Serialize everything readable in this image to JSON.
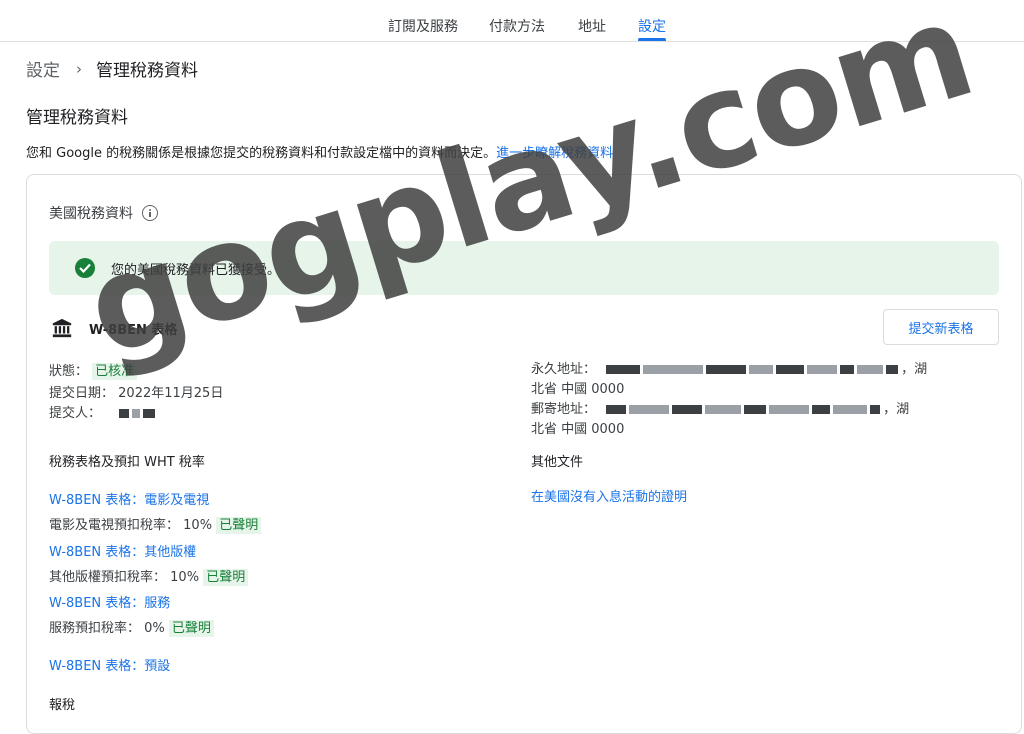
{
  "nav": {
    "tabs": [
      {
        "label": "訂閱及服務"
      },
      {
        "label": "付款方法"
      },
      {
        "label": "地址"
      },
      {
        "label": "設定",
        "active": true
      }
    ]
  },
  "breadcrumb": {
    "root": "設定",
    "current": "管理稅務資料"
  },
  "page": {
    "title": "管理稅務資料",
    "description": "您和 Google 的稅務關係是根據您提交的稅務資料和付款設定檔中的資料而決定。",
    "learn_more": "進一步瞭解稅務資料"
  },
  "card": {
    "title": "美國稅務資料",
    "banner": "您的美國稅務資料已獲接受。",
    "form_name": "W-8BEN 表格",
    "new_form_button": "提交新表格",
    "status_label": "狀態：",
    "status_value": "已核准",
    "submit_date_label": "提交日期：",
    "submit_date_value": "2022年11月25日",
    "submitter_label": "提交人：",
    "withholding_title": "稅務表格及預扣 WHT 稅率",
    "forms": [
      {
        "link": "W-8BEN 表格：電影及電視",
        "rate_label": "電影及電視預扣稅率：",
        "rate": "10%",
        "status": "已聲明"
      },
      {
        "link": "W-8BEN 表格：其他版權",
        "rate_label": "其他版權預扣稅率：",
        "rate": "10%",
        "status": "已聲明"
      },
      {
        "link": "W-8BEN 表格：服務",
        "rate_label": "服務預扣稅率：",
        "rate": "0%",
        "status": "已聲明"
      }
    ],
    "default_form": "W-8BEN 表格：預設",
    "reporting_title": "報稅",
    "addr1_label": "永久地址：",
    "addr1_end": "，湖",
    "addr1_line2": "北省 中國 0000",
    "addr2_label": "郵寄地址：",
    "addr2_end": "，湖",
    "addr2_line2": "北省 中國 0000",
    "other_docs_title": "其他文件",
    "other_docs_link": "在美國沒有入息活動的證明"
  },
  "watermark": "gogplay.com",
  "colors": {
    "accent": "#1a73e8",
    "success": "#188038",
    "success_bg": "#e6f4ea"
  }
}
